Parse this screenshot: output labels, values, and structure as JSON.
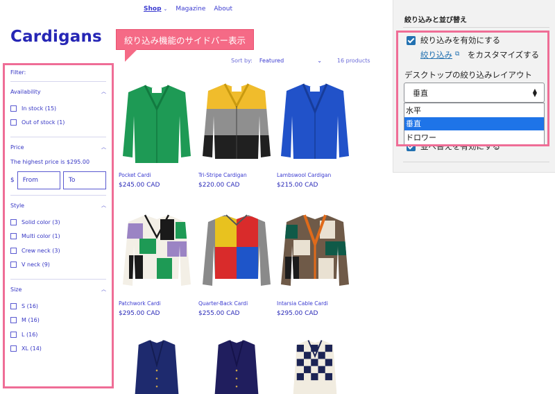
{
  "nav": {
    "shop": "Shop",
    "magazine": "Magazine",
    "about": "About"
  },
  "page_title": "Cardigans",
  "callout": "絞り込み機能のサイドバー表示",
  "sort": {
    "label": "Sort by:",
    "value": "Featured",
    "count": "16 products"
  },
  "filter": {
    "heading": "Filter:",
    "availability": {
      "title": "Availability",
      "options": [
        "In stock (15)",
        "Out of stock (1)"
      ]
    },
    "price": {
      "title": "Price",
      "note": "The highest price is $295.00",
      "currency": "$",
      "from_placeholder": "From",
      "to_placeholder": "To"
    },
    "style": {
      "title": "Style",
      "options": [
        "Solid color (3)",
        "Multi color (1)",
        "Crew neck (3)",
        "V neck (9)"
      ]
    },
    "size": {
      "title": "Size",
      "options": [
        "S (16)",
        "M (16)",
        "L (16)",
        "XL (14)"
      ]
    }
  },
  "products": [
    {
      "name": "Pocket Cardi",
      "price": "$245.00 CAD"
    },
    {
      "name": "Tri-Stripe Cardigan",
      "price": "$220.00 CAD"
    },
    {
      "name": "Lambswool Cardigan",
      "price": "$215.00 CAD"
    },
    {
      "name": "Patchwork Cardi",
      "price": "$295.00 CAD"
    },
    {
      "name": "Quarter-Back Cardi",
      "price": "$255.00 CAD"
    },
    {
      "name": "Intarsia Cable Cardi",
      "price": "$295.00 CAD"
    }
  ],
  "panel": {
    "title": "絞り込みと並び替え",
    "enable_filter": "絞り込みを有効にする",
    "customize_link": "絞り込み",
    "customize_suffix": "をカスタマイズする",
    "layout_label": "デスクトップの絞り込みレイアウト",
    "layout_value": "垂直",
    "layout_options": [
      "水平",
      "垂直",
      "ドロワー"
    ],
    "enable_sort": "並べ替えを有効にする"
  },
  "colors": {
    "accent": "#2a2ab8",
    "highlight": "#ef6d96",
    "callout": "#f56a86",
    "wp_blue": "#2271b1",
    "selected": "#1e74e8"
  }
}
